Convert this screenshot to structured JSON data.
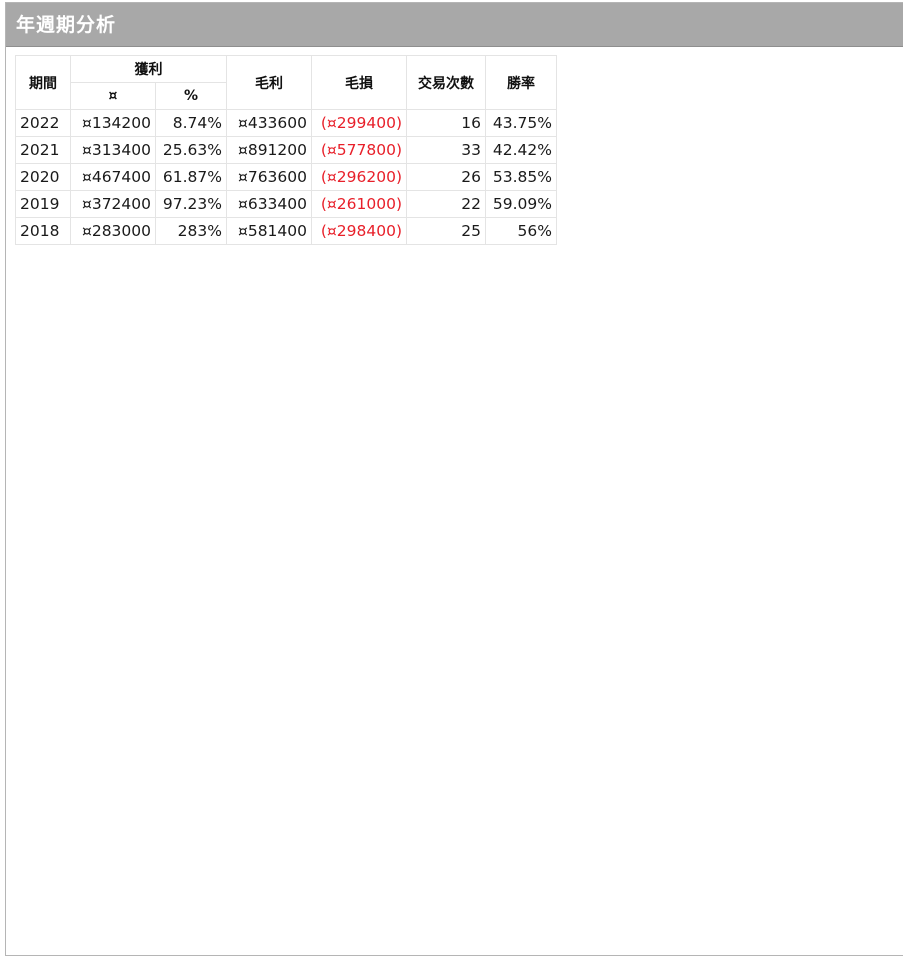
{
  "panel": {
    "title": "年週期分析"
  },
  "table": {
    "headers": {
      "period": "期間",
      "profit": "獲利",
      "profit_amount": "¤",
      "profit_percent": "%",
      "gross_profit": "毛利",
      "gross_loss": "毛損",
      "trade_count": "交易次數",
      "win_rate": "勝率"
    },
    "rows": [
      {
        "period": "2022",
        "profit_amount": "¤134200",
        "profit_percent": "8.74%",
        "gross_profit": "¤433600",
        "gross_loss": "(¤299400)",
        "trade_count": "16",
        "win_rate": "43.75%"
      },
      {
        "period": "2021",
        "profit_amount": "¤313400",
        "profit_percent": "25.63%",
        "gross_profit": "¤891200",
        "gross_loss": "(¤577800)",
        "trade_count": "33",
        "win_rate": "42.42%"
      },
      {
        "period": "2020",
        "profit_amount": "¤467400",
        "profit_percent": "61.87%",
        "gross_profit": "¤763600",
        "gross_loss": "(¤296200)",
        "trade_count": "26",
        "win_rate": "53.85%"
      },
      {
        "period": "2019",
        "profit_amount": "¤372400",
        "profit_percent": "97.23%",
        "gross_profit": "¤633400",
        "gross_loss": "(¤261000)",
        "trade_count": "22",
        "win_rate": "59.09%"
      },
      {
        "period": "2018",
        "profit_amount": "¤283000",
        "profit_percent": "283%",
        "gross_profit": "¤581400",
        "gross_loss": "(¤298400)",
        "trade_count": "25",
        "win_rate": "56%"
      }
    ]
  },
  "colors": {
    "header_bg": "#a8a8a8",
    "loss_text": "#e8202a"
  }
}
